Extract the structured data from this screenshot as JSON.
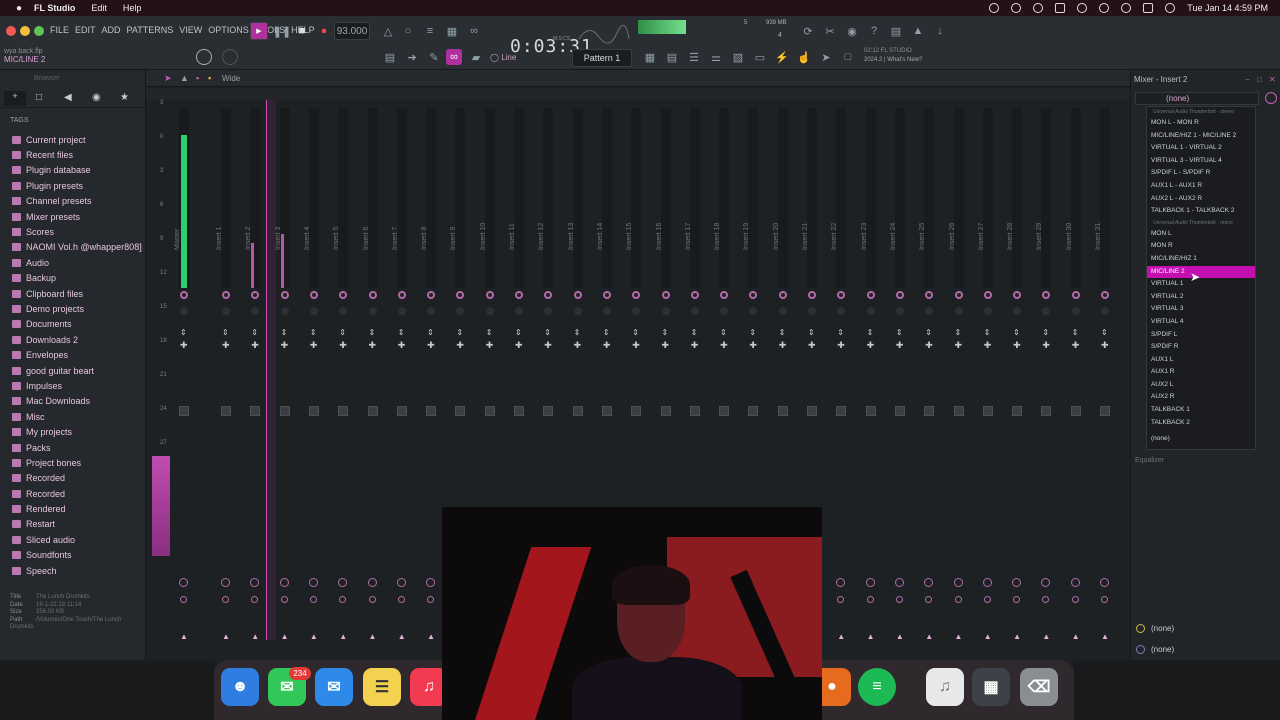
{
  "menubar": {
    "app_name": "FL Studio",
    "items": [
      "Edit",
      "Help"
    ],
    "datetime": "Tue Jan 14  4:59 PM"
  },
  "fl_menu": [
    "FILE",
    "EDIT",
    "ADD",
    "PATTERNS",
    "VIEW",
    "OPTIONS",
    "TOOLS",
    "HELP"
  ],
  "toolbar": {
    "tempo": "93.000",
    "time": "0:03:31",
    "time_sub": "M:S:CS",
    "cpu": "5",
    "memory": "939 MB",
    "polyphony": "4",
    "pattern": "Pattern 1",
    "snap": "Line",
    "version": "02:12 FL STUDIO",
    "news": "2024.2 | What's New?",
    "hint_line1": "wya back.flp",
    "hint_line2": "MIC/LINE 2"
  },
  "browser": {
    "title": "Browser",
    "tags_label": "TAGS",
    "items": [
      "Current project",
      "Recent files",
      "Plugin database",
      "Plugin presets",
      "Channel presets",
      "Mixer presets",
      "Scores",
      "NAOMI Vol.h @whapper808]",
      "Audio",
      "Backup",
      "Clipboard files",
      "Demo projects",
      "Documents",
      "Downloads 2",
      "Envelopes",
      "good guitar beart",
      "Impulses",
      "Mac Downloads",
      "Misc",
      "My projects",
      "Packs",
      "Project bones",
      "Recorded",
      "Recorded",
      "Rendered",
      "Restart",
      "Sliced audio",
      "Soundfonts",
      "Speech"
    ],
    "meta": {
      "title_label": "Title",
      "title_value": "The Lunch Drumkits",
      "date_label": "Date",
      "date_value": "16-1-22 19:11:14",
      "size_label": "Size",
      "size_value": "256.00 KB",
      "path_label": "Path",
      "path_value": "/Volumes/One Touch/The Lunch Drumkits"
    }
  },
  "mixer": {
    "view_label": "Wide",
    "strips": [
      "Master",
      "Insert 1",
      "Insert 2",
      "Insert 3",
      "Insert 4",
      "Insert 5",
      "Insert 6",
      "Insert 7",
      "Insert 8",
      "Insert 9",
      "Insert 10",
      "Insert 11",
      "Insert 12",
      "Insert 13",
      "Insert 14",
      "Insert 15",
      "Insert 16",
      "Insert 17",
      "Insert 18",
      "Insert 19",
      "Insert 20",
      "Insert 21",
      "Insert 22",
      "Insert 23",
      "Insert 24",
      "Insert 25",
      "Insert 26",
      "Insert 27",
      "Insert 28",
      "Insert 29",
      "Insert 30",
      "Insert 31"
    ],
    "db_scale": [
      "3",
      "0",
      "3",
      "6",
      "9",
      "12",
      "15",
      "18",
      "21",
      "24",
      "27"
    ],
    "master_level": 0.85,
    "insert2_level": 0.25,
    "insert3_level": 0.3
  },
  "insert_panel": {
    "title": "Mixer - Insert 2",
    "input_selected": "(none)",
    "equalizer_label": "Equalizer",
    "output1": "(none)",
    "output2": "(none)"
  },
  "dropdown": {
    "section_stereo": "Universal Audio Thunderbolt - stereo",
    "stereo": [
      "MON L - MON R",
      "MIC/LINE/HIZ 1 - MIC/LINE 2",
      "VIRTUAL 1 - VIRTUAL 2",
      "VIRTUAL 3 - VIRTUAL 4",
      "S/PDIF L - S/PDIF R",
      "AUX1 L - AUX1 R",
      "AUX2 L - AUX2 R",
      "TALKBACK 1 - TALKBACK 2"
    ],
    "section_mono": "Universal Audio Thunderbolt - mono",
    "mono": [
      "MON L",
      "MON R",
      "MIC/LINE/HIZ 1",
      "MIC/LINE 2",
      "VIRTUAL 1",
      "VIRTUAL 2",
      "VIRTUAL 3",
      "VIRTUAL 4",
      "S/PDIF L",
      "S/PDIF R",
      "AUX1 L",
      "AUX1 R",
      "AUX2 L",
      "AUX2 R",
      "TALKBACK 1",
      "TALKBACK 2"
    ],
    "none": "(none)",
    "highlighted": "MIC/LINE 2"
  },
  "dock": {
    "messages_badge": "234"
  },
  "colors": {
    "accent": "#c30fb0",
    "meter_green": "#5ce07a",
    "label_pink": "#e6c6e2"
  }
}
